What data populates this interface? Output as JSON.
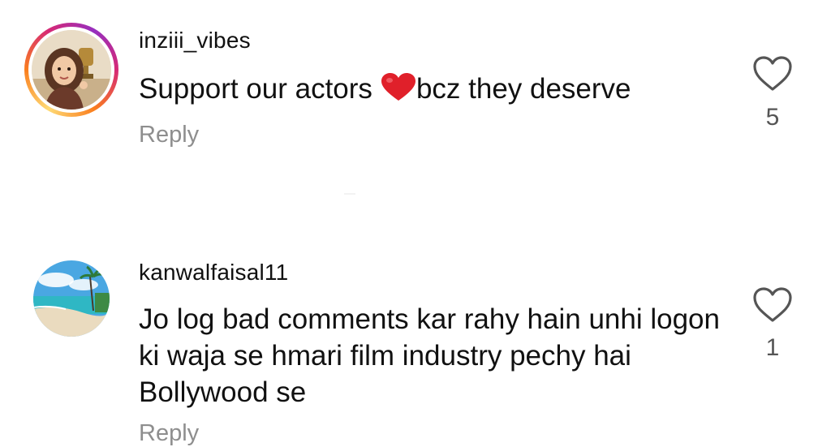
{
  "comments": [
    {
      "username": "inziii_vibes",
      "text_before": "Support our actors",
      "emoji": "red-heart",
      "text_after": "bcz they deserve",
      "reply_label": "Reply",
      "likes": "5",
      "avatar": "illustrated-girl-with-trophy"
    },
    {
      "username": "kanwalfaisal11",
      "text": "Jo log bad comments kar rahy hain unhi logon ki waja se hmari film industry pechy hai  Bollywood se",
      "reply_label": "Reply",
      "likes": "1",
      "avatar": "tropical-beach"
    }
  ],
  "icons": {
    "like": "heart-outline-icon"
  },
  "colors": {
    "text": "#111111",
    "secondary": "#8e8e8e",
    "heart_emoji": "#e0202a"
  }
}
